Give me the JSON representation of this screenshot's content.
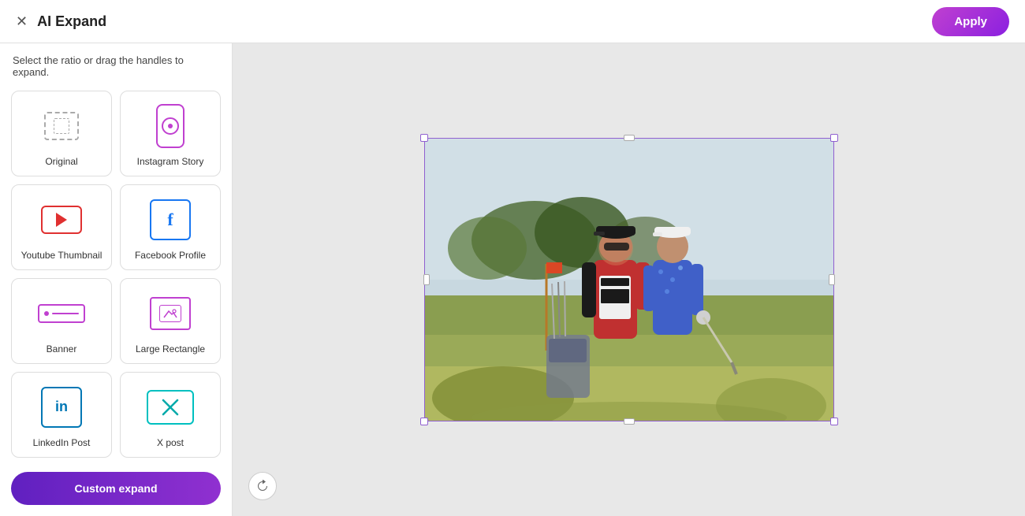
{
  "header": {
    "title": "AI Expand",
    "apply_label": "Apply"
  },
  "sidebar": {
    "hint": "Select the ratio or drag the handles to expand.",
    "custom_expand_label": "Custom expand",
    "ratio_cards": [
      {
        "id": "original",
        "label": "Original",
        "icon_type": "original"
      },
      {
        "id": "instagram-story",
        "label": "Instagram Story",
        "icon_type": "instagram"
      },
      {
        "id": "youtube-thumbnail",
        "label": "Youtube Thumbnail",
        "icon_type": "youtube"
      },
      {
        "id": "facebook-profile",
        "label": "Facebook Profile",
        "icon_type": "facebook"
      },
      {
        "id": "banner",
        "label": "Banner",
        "icon_type": "banner"
      },
      {
        "id": "large-rectangle",
        "label": "Large Rectangle",
        "icon_type": "large-rect"
      },
      {
        "id": "linkedin-post",
        "label": "LinkedIn Post",
        "icon_type": "linkedin"
      },
      {
        "id": "x-post",
        "label": "X post",
        "icon_type": "xpost"
      }
    ]
  },
  "canvas": {
    "reset_title": "Reset"
  }
}
